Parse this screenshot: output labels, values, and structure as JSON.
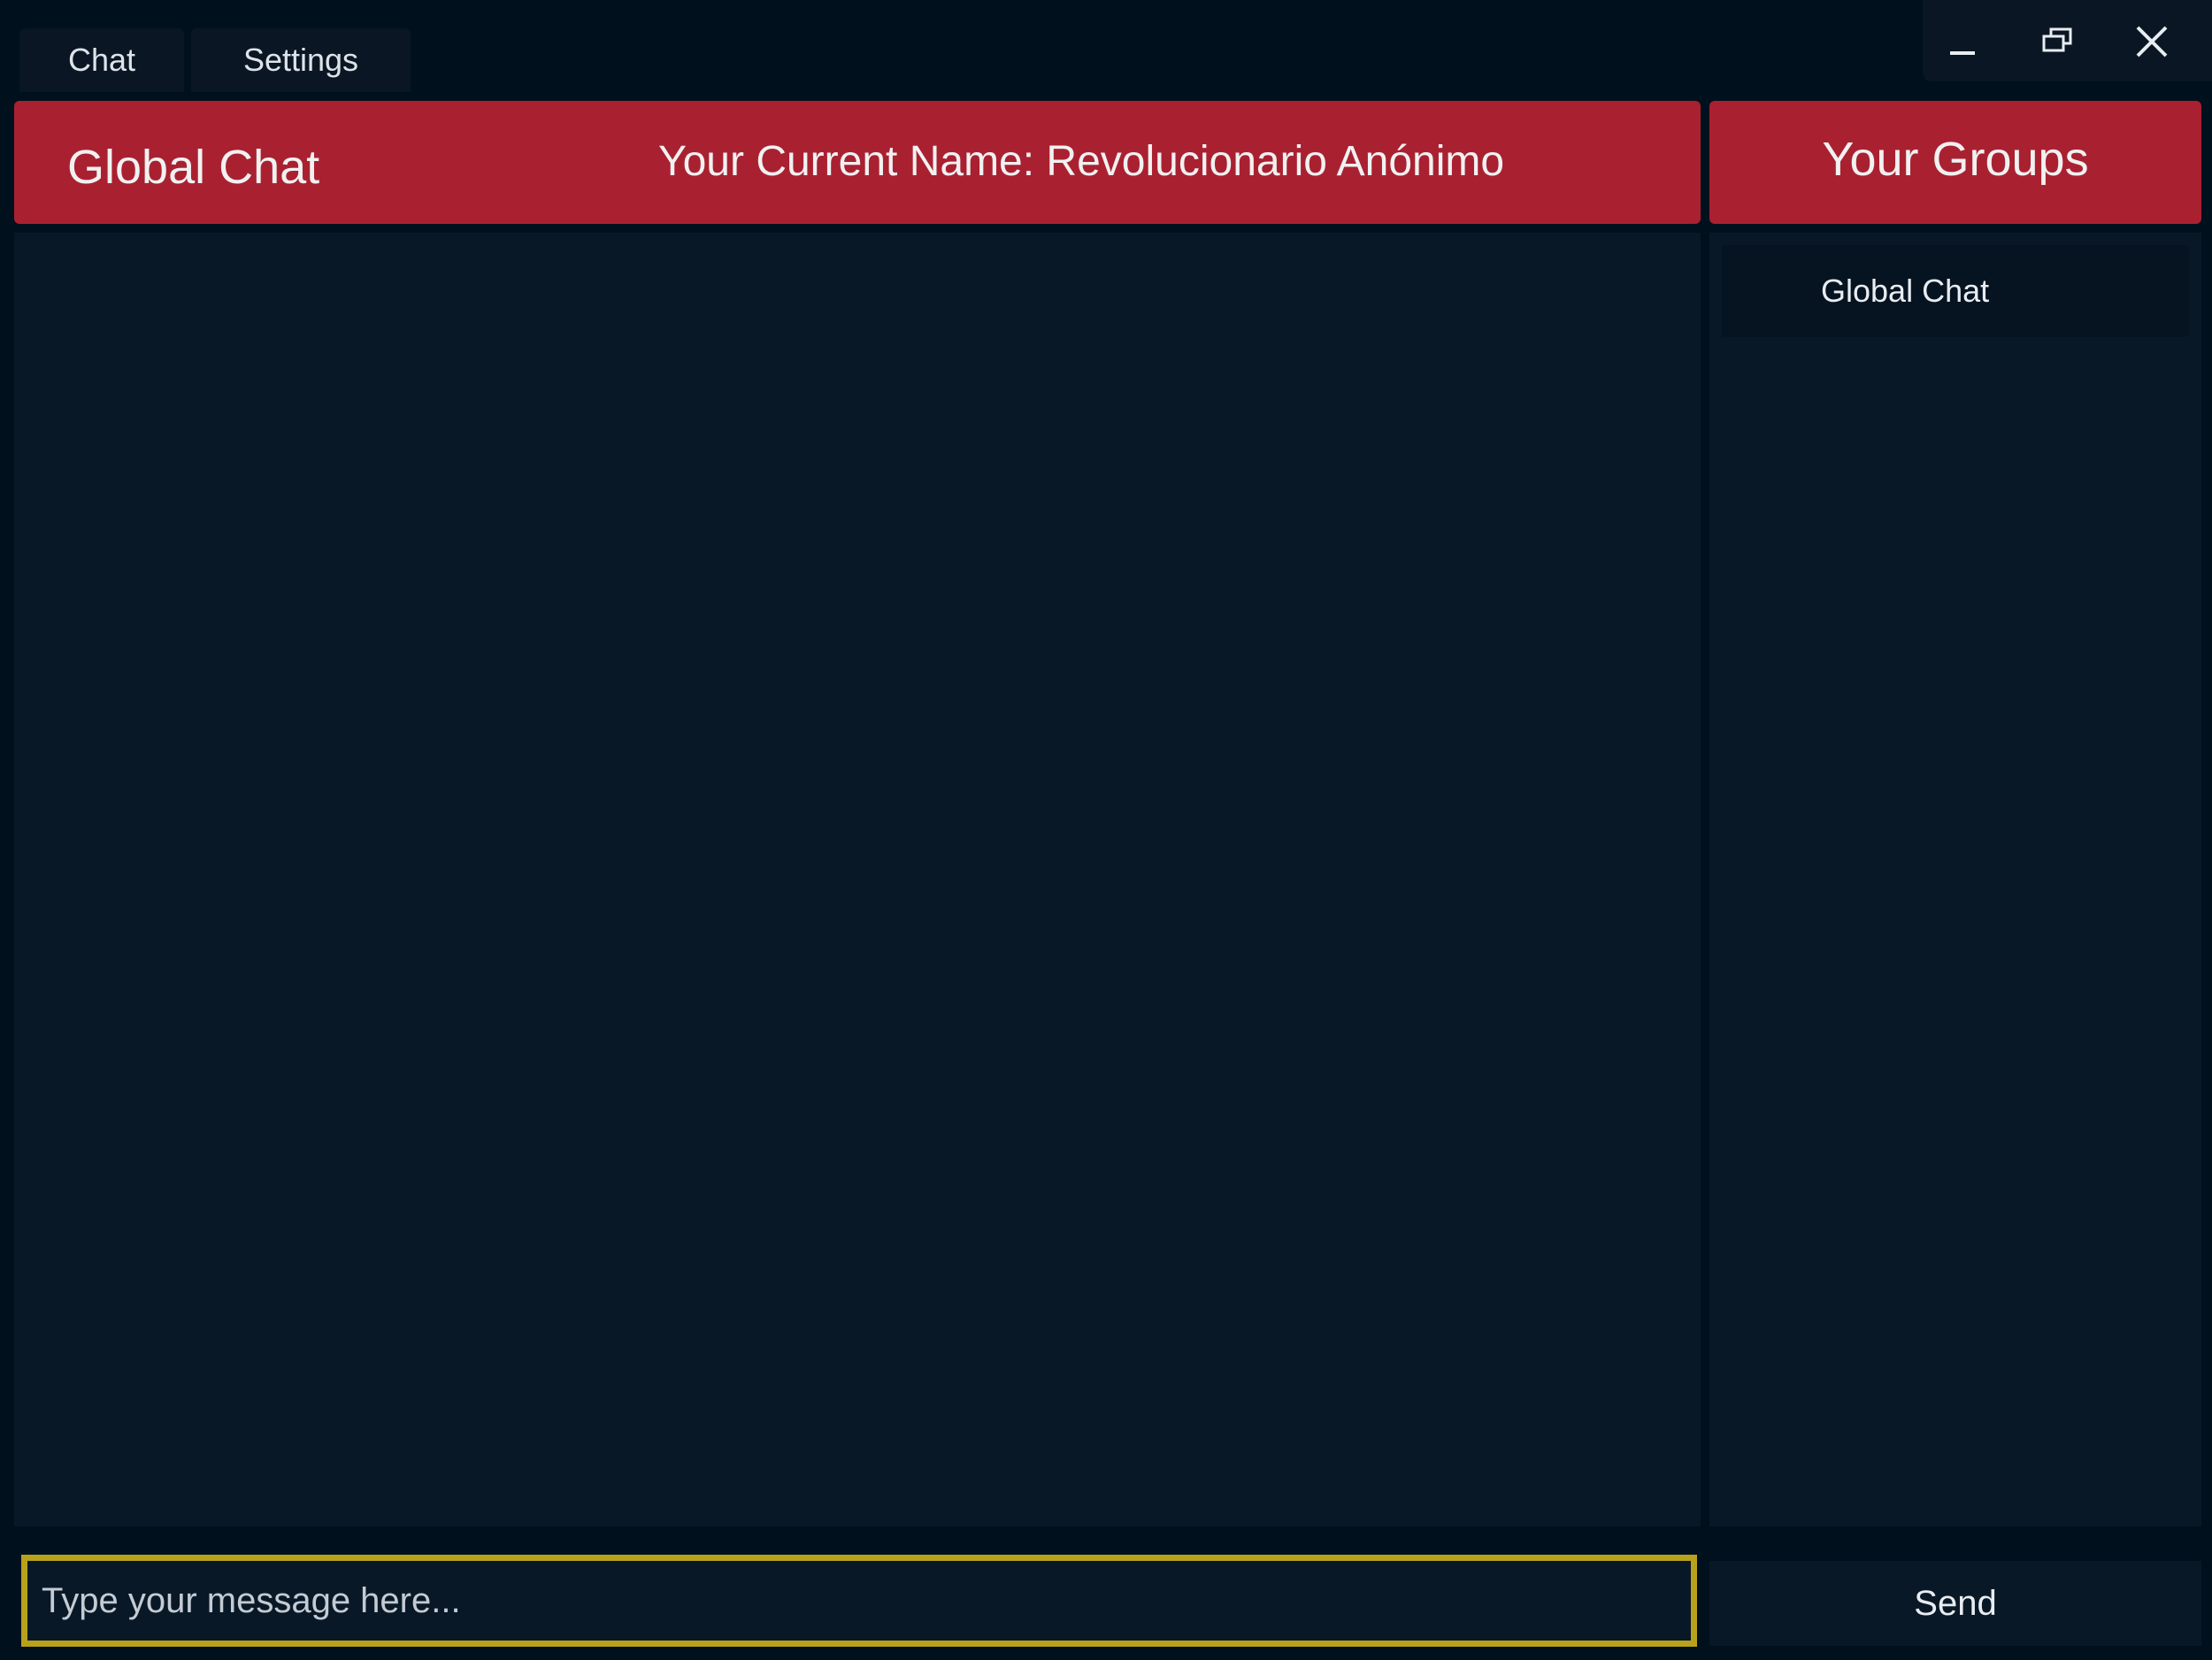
{
  "tabs": [
    {
      "label": "Chat"
    },
    {
      "label": "Settings"
    }
  ],
  "window_controls": {
    "icons": [
      "minimize-icon",
      "restore-icon",
      "close-icon"
    ]
  },
  "header": {
    "title": "Global Chat",
    "current_name": "Your Current Name: Revolucionario Anónimo"
  },
  "groups": {
    "title": "Your Groups",
    "items": [
      {
        "label": "Global Chat"
      }
    ]
  },
  "composer": {
    "placeholder": "Type your message here...",
    "value": "",
    "send_label": "Send"
  },
  "colors": {
    "accent": "#a92131",
    "background": "#00101d",
    "panel": "#091827",
    "focus_border": "#b8a21b"
  }
}
